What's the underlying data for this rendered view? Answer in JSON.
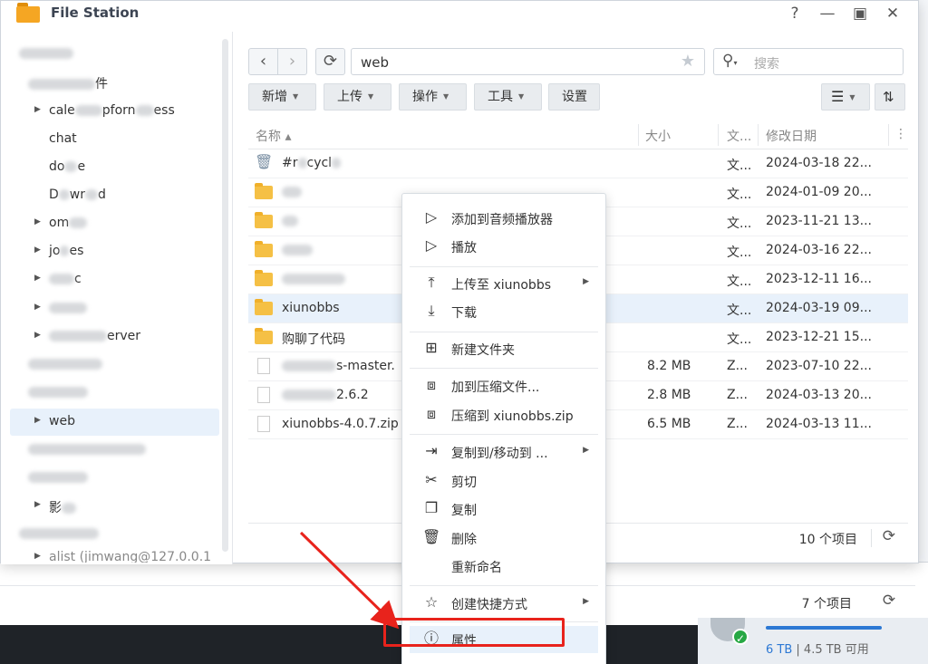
{
  "window": {
    "title": "File Station"
  },
  "sidebar": {
    "items": [
      {
        "label": "件"
      },
      {
        "label": "cale",
        "label2": "pforn",
        "label3": "ess"
      },
      {
        "label": "chat"
      },
      {
        "label": "do",
        "label2": "e"
      },
      {
        "label": "D",
        "label2": "wr",
        "label3": "d"
      },
      {
        "label": "om"
      },
      {
        "label": "jo",
        "label2": "es"
      },
      {
        "label": "c"
      },
      {
        "label": "erver"
      },
      {
        "label": "web"
      },
      {
        "label": "影"
      },
      {
        "label": "alist (jimwang@127.0.0.1"
      }
    ]
  },
  "toolbar": {
    "path": "web",
    "search_placeholder": "搜索",
    "buttons": [
      "新增",
      "上传",
      "操作",
      "工具",
      "设置"
    ]
  },
  "columns": {
    "name": "名称 ▴",
    "size": "大小",
    "type": "文...",
    "modified": "修改日期"
  },
  "files": [
    {
      "name": "#r",
      "name2": "cycl",
      "size": "",
      "type": "文...",
      "date": "2024-03-18 22..."
    },
    {
      "name": "",
      "size": "",
      "type": "文...",
      "date": "2024-01-09 20..."
    },
    {
      "name": "",
      "size": "",
      "type": "文...",
      "date": "2023-11-21 13..."
    },
    {
      "name": "",
      "size": "",
      "type": "文...",
      "date": "2024-03-16 22..."
    },
    {
      "name": "",
      "size": "",
      "type": "文...",
      "date": "2023-12-11 16..."
    },
    {
      "name": "xiunobbs",
      "size": "",
      "type": "文...",
      "date": "2024-03-19 09..."
    },
    {
      "name": "购聊了代码",
      "size": "",
      "type": "文...",
      "date": "2023-12-21 15..."
    },
    {
      "name": "s-master.",
      "size": "8.2 MB",
      "type": "Z...",
      "date": "2023-07-10 22..."
    },
    {
      "name": "2.6.2",
      "size": "2.8 MB",
      "type": "Z...",
      "date": "2024-03-13 20..."
    },
    {
      "name": "xiunobbs-4.0.7.zip",
      "size": "6.5 MB",
      "type": "Z...",
      "date": "2024-03-13 11..."
    }
  ],
  "footer": {
    "count": "10 个项目"
  },
  "bg_footer": {
    "count": "7 个项目"
  },
  "storage": {
    "total": "6 TB",
    "sep": " | ",
    "available": "4.5 TB 可用"
  },
  "menu": {
    "items": [
      {
        "label": "添加到音频播放器",
        "icon": "play-outline-icon"
      },
      {
        "label": "播放",
        "icon": "play-outline-icon"
      },
      {
        "label": "上传至 xiunobbs",
        "icon": "upload-icon"
      },
      {
        "label": "下载",
        "icon": "download-icon"
      },
      {
        "label": "新建文件夹",
        "icon": "new-folder-icon"
      },
      {
        "label": "加到压缩文件...",
        "icon": "archive-icon"
      },
      {
        "label": "压缩到 xiunobbs.zip",
        "icon": "archive-icon"
      },
      {
        "label": "复制到/移动到 ...",
        "icon": "copy-move-icon"
      },
      {
        "label": "剪切",
        "icon": "scissors-icon"
      },
      {
        "label": "复制",
        "icon": "copy-icon"
      },
      {
        "label": "删除",
        "icon": "trash-icon"
      },
      {
        "label": "重新命名",
        "icon": ""
      },
      {
        "label": "创建快捷方式",
        "icon": "star-outline-icon"
      },
      {
        "label": "属性",
        "icon": "info-icon"
      }
    ]
  },
  "colors": {
    "accent": "#2c78d4",
    "selection": "#e8f1fb",
    "annotation": "#e8231c"
  }
}
